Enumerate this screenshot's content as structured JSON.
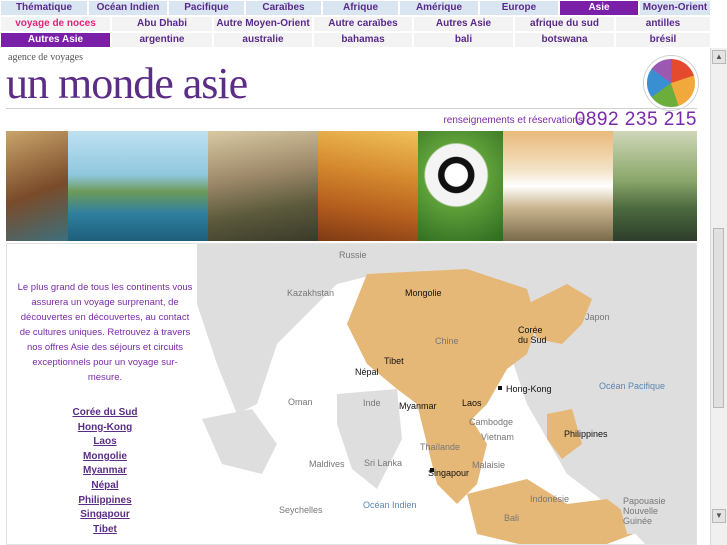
{
  "nav": {
    "row1": [
      "Thématique",
      "Océan Indien",
      "Pacifique",
      "Caraïbes",
      "Afrique",
      "Amérique",
      "Europe",
      "Asie",
      "Moyen-Orient"
    ],
    "row2": [
      "voyage de noces",
      "Abu Dhabi",
      "Autre Moyen-Orient",
      "Autre caraïbes",
      "Autres Asie",
      "afrique du sud",
      "antilles"
    ],
    "row3": [
      "Autres Asie",
      "argentine",
      "australie",
      "bahamas",
      "bali",
      "botswana",
      "brésil"
    ]
  },
  "header": {
    "agency": "agence de voyages",
    "brand": "un monde asie",
    "phone_label": "renseignements et réservations",
    "phone_number": "0892 235 215"
  },
  "intro": "Le plus grand de tous les continents vous assurera un voyage surprenant, de découvertes en découvertes, au contact de cultures uniques. Retrouvez à travers nos offres Asie des séjours et circuits exceptionnels pour un voyage sur-mesure.",
  "destinations": [
    "Corée du Sud",
    "Hong-Kong",
    "Laos",
    "Mongolie",
    "Myanmar",
    "Népal",
    "Philippines",
    "Singapour",
    "Tibet"
  ],
  "map_labels": {
    "russie": "Russie",
    "kazakhstan": "Kazakhstan",
    "mongolie": "Mongolie",
    "chine": "Chine",
    "tibet": "Tibet",
    "nepal": "Népal",
    "coree": "Corée du Sud",
    "japon": "Japon",
    "hongkong": "Hong-Kong",
    "oman": "Oman",
    "inde": "Inde",
    "myanmar": "Myanmar",
    "laos": "Laos",
    "cambodge": "Cambodge",
    "vietnam": "Vietnam",
    "thailande": "Thaïlande",
    "philippines": "Philippines",
    "ocean_pacifique": "Océan Pacifique",
    "maldives": "Maldives",
    "srilanka": "Sri Lanka",
    "malaisie": "Malaisie",
    "singapour": "Singapour",
    "seychelles": "Seychelles",
    "ocean_indien": "Océan Indien",
    "indonesie": "Indonésie",
    "papouasie": "Papouasie Nouvelle Guinée",
    "bali": "Bali"
  },
  "colors": {
    "nav_active": "#7a1fa8",
    "brand": "#5b2d86",
    "map_highlight": "#e6b877",
    "map_land": "#dcdcdc"
  }
}
